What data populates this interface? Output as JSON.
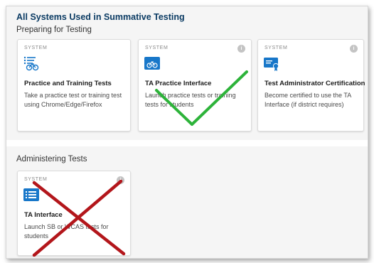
{
  "page": {
    "title": "All Systems Used in Summative Testing"
  },
  "sections": [
    {
      "title": "Preparing for Testing"
    },
    {
      "title": "Administering Tests"
    }
  ],
  "cards": [
    {
      "system_label": "SYSTEM",
      "icon": "practice-tests-icon",
      "title": "Practice and Training Tests",
      "description": "Take a practice test or training test using Chrome/Edge/Firefox",
      "has_info": false
    },
    {
      "system_label": "SYSTEM",
      "icon": "ta-practice-icon",
      "title": "TA Practice Interface",
      "description": "Launch practice tests or training tests for students",
      "has_info": true
    },
    {
      "system_label": "SYSTEM",
      "icon": "certificate-icon",
      "title": "Test Administrator Certification",
      "description": "Become certified to use the TA Interface (if district requires)",
      "has_info": true
    },
    {
      "system_label": "SYSTEM",
      "icon": "ta-interface-icon",
      "title": "TA Interface",
      "description": "Launch SB or WCAS tests for students",
      "has_info": true
    }
  ],
  "annotations": {
    "check_color": "#2db33a",
    "cross_color": "#b3161b"
  },
  "colors": {
    "title": "#0b3b63",
    "icon_blue": "#1877c9"
  }
}
